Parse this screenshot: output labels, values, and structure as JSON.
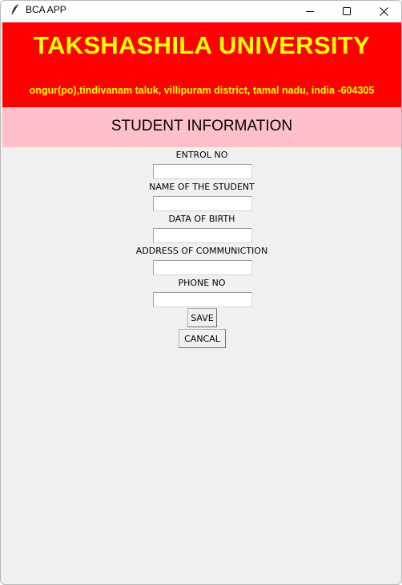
{
  "window": {
    "app_title": "BCA APP",
    "icon": "feather-icon",
    "controls": [
      "minimize-icon",
      "maximize-icon",
      "close-icon"
    ]
  },
  "header": {
    "university_name": "TAKSHASHILA UNIVERSITY",
    "address": "ongur(po),tindivanam taluk, villipuram district, tamal nadu, india -604305",
    "banner_color": "#ff0000",
    "text_color": "#ffff00"
  },
  "section": {
    "title": "STUDENT INFORMATION",
    "background": "#ffc0cb"
  },
  "form": {
    "enrol_label": "ENTROL NO",
    "enrol_value": "",
    "name_label": "NAME OF THE STUDENT",
    "name_value": "",
    "dob_label": "DATA OF BIRTH",
    "dob_value": "",
    "address_label": "ADDRESS OF COMMUNICTION",
    "address_value": "",
    "phone_label": "PHONE NO",
    "phone_value": ""
  },
  "buttons": {
    "save": "SAVE",
    "cancel": "CANCAL"
  }
}
